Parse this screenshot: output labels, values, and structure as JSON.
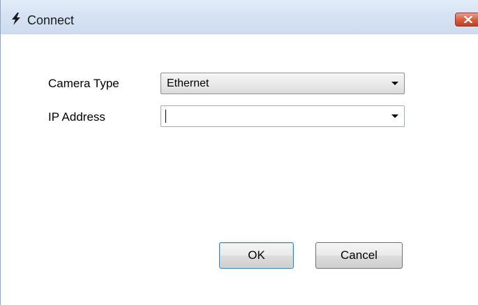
{
  "window": {
    "title": "Connect",
    "app_icon": "lightning-bolt-icon",
    "close_icon": "close-x-icon"
  },
  "form": {
    "camera_type": {
      "label": "Camera Type",
      "selected": "Ethernet"
    },
    "ip_address": {
      "label": "IP Address",
      "value": ""
    }
  },
  "buttons": {
    "ok": "OK",
    "cancel": "Cancel"
  },
  "colors": {
    "title_bar": "#d6e3f4",
    "close_button": "#d5603f",
    "ok_focus_border": "#3c7fb1"
  }
}
